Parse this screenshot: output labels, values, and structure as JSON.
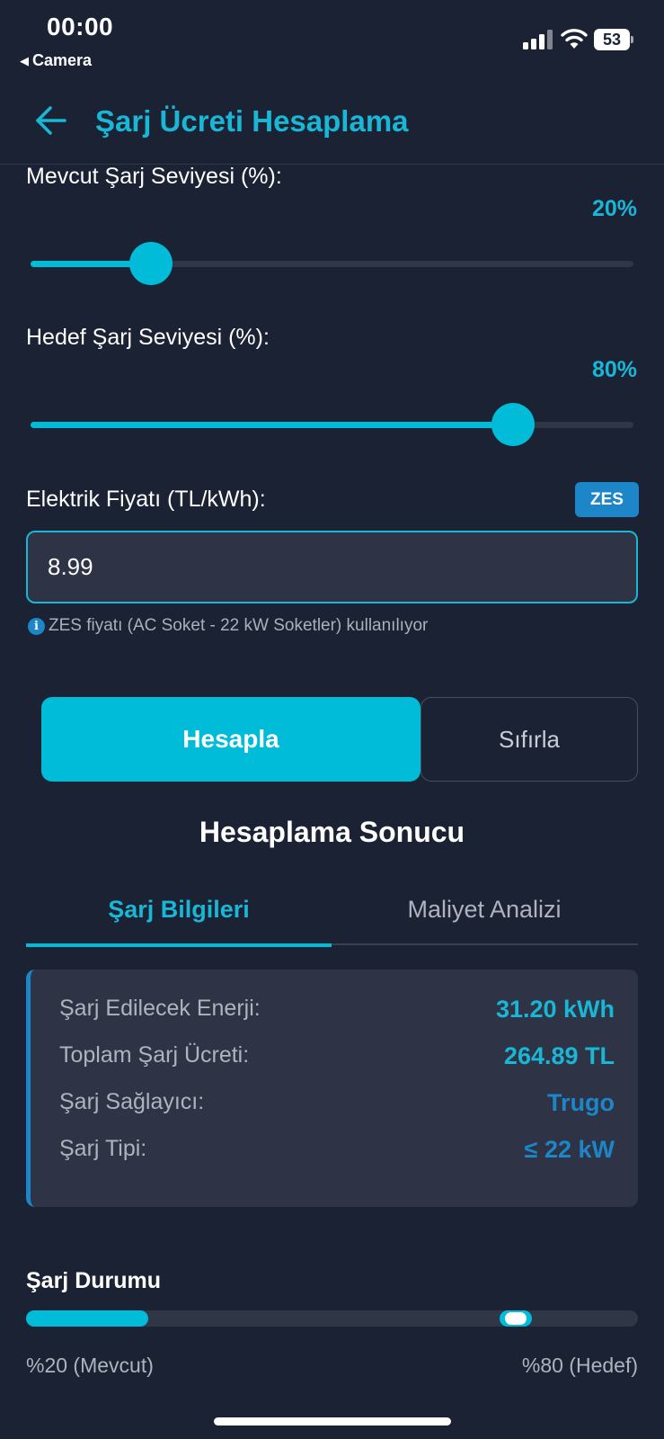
{
  "status": {
    "time": "00:00",
    "back_app": "Camera",
    "battery": "53"
  },
  "header": {
    "title": "Şarj Ücreti Hesaplama"
  },
  "current_charge": {
    "label": "Mevcut Şarj Seviyesi (%):",
    "value_text": "20%",
    "value": 20
  },
  "target_charge": {
    "label": "Hedef Şarj Seviyesi (%):",
    "value_text": "80%",
    "value": 80
  },
  "price": {
    "label": "Elektrik Fiyatı (TL/kWh):",
    "badge": "ZES",
    "input_value": "8.99",
    "info_icon": "i",
    "info_text": "ZES fiyatı (AC Soket - 22 kW Soketler) kullanılıyor"
  },
  "actions": {
    "calculate": "Hesapla",
    "reset": "Sıfırla"
  },
  "result": {
    "title": "Hesaplama Sonucu",
    "tabs": [
      {
        "label": "Şarj Bilgileri",
        "active": true
      },
      {
        "label": "Maliyet Analizi",
        "active": false
      }
    ],
    "rows": [
      {
        "key": "Şarj Edilecek Enerji:",
        "value": "31.20 kWh"
      },
      {
        "key": "Toplam Şarj Ücreti:",
        "value": "264.89 TL"
      },
      {
        "key": "Şarj Sağlayıcı:",
        "value": "Trugo"
      },
      {
        "key": "Şarj Tipi:",
        "value": "≤ 22 kW"
      }
    ]
  },
  "charge_status": {
    "title": "Şarj Durumu",
    "current": 20,
    "target": 80,
    "current_label": "%20 (Mevcut)",
    "target_label": "%80 (Hedef)"
  },
  "colors": {
    "accent": "#00bcd9",
    "accent_text": "#19b6d6",
    "badge": "#1c86c8",
    "background": "#1b2233",
    "card": "#2e3446"
  }
}
